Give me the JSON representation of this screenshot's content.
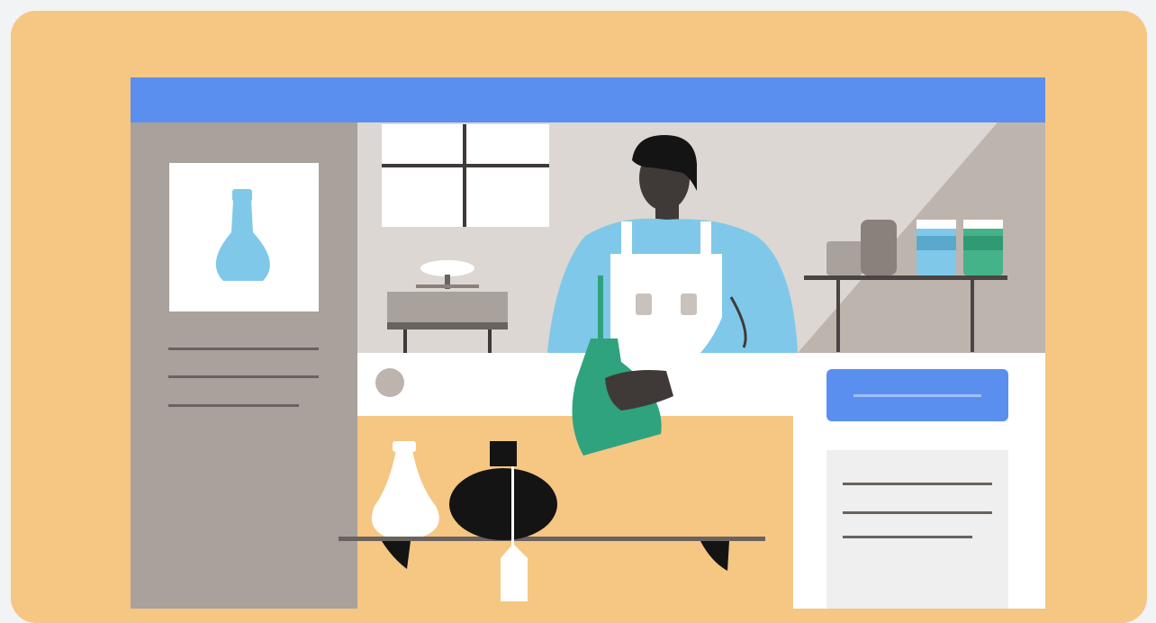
{
  "illustration": {
    "icons": {
      "sidebar_image": "flask-icon",
      "person": "pharmacist-person-icon",
      "held_item": "flask-icon",
      "shelf_items": [
        "vase-icon",
        "vase-icon",
        "price-tag-icon"
      ],
      "back_shelf_items": [
        "jar-icon",
        "jar-icon"
      ]
    },
    "colors": {
      "background": "#f6c683",
      "header_bar": "#5a8ff0",
      "sidebar": "#a9a19b",
      "wall": "#dcd7d2",
      "shirt": "#7fc8ea",
      "bottle_green": "#2fa37e",
      "panel": "#ffffff",
      "panel_button": "#5a8ff0"
    }
  }
}
